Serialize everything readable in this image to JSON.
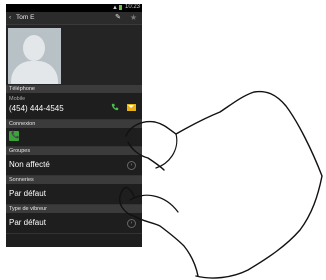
{
  "status_bar": {
    "time": "10:23",
    "signal_icon": "signal-icon",
    "battery_icon": "battery-icon"
  },
  "action_bar": {
    "back_icon": "chevron-left-icon",
    "title": "Tom E",
    "edit_icon": "pencil-icon",
    "favorite_icon": "star-icon"
  },
  "photo": {
    "icon": "contact-avatar"
  },
  "sections": {
    "telephone": "Téléphone",
    "connexion": "Connexion",
    "groupes": "Groupes",
    "sonneries": "Sonneries",
    "vibreur": "Type de vibreur"
  },
  "phone": {
    "type": "Mobile",
    "number": "(454) 444-4545",
    "call_icon": "phone-icon",
    "message_icon": "envelope-icon"
  },
  "connexion": {
    "icon": "phone-app-icon"
  },
  "groupes": {
    "value": "Non affecté"
  },
  "sonneries": {
    "value": "Par défaut"
  },
  "vibreur": {
    "value": "Par défaut"
  },
  "colors": {
    "accent_green": "#3aa53a",
    "message_yellow": "#e9b214",
    "header_bg": "#3b3b3b"
  }
}
